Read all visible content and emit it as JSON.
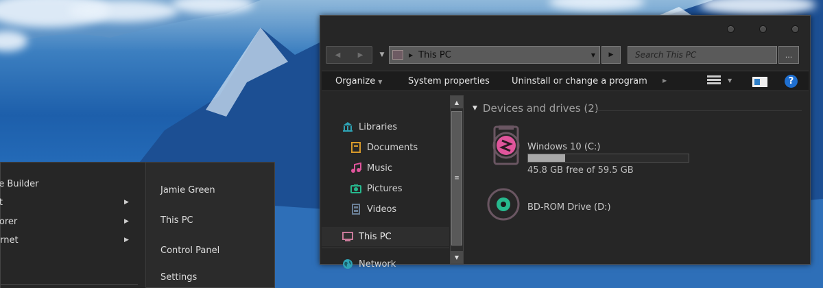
{
  "explorer": {
    "address": {
      "path": "This PC"
    },
    "search": {
      "placeholder": "Search This PC",
      "button_label": "..."
    },
    "commandbar": {
      "organize": "Organize",
      "system_properties": "System properties",
      "uninstall": "Uninstall or change a program"
    },
    "navpane": {
      "items": [
        {
          "label": "Libraries",
          "icon": "library-icon",
          "color": "#2ea3b5"
        },
        {
          "label": "Documents",
          "icon": "document-icon",
          "color": "#d89a2a"
        },
        {
          "label": "Music",
          "icon": "music-icon",
          "color": "#e0559c"
        },
        {
          "label": "Pictures",
          "icon": "camera-icon",
          "color": "#27b98e"
        },
        {
          "label": "Videos",
          "icon": "film-icon",
          "color": "#6a7f96"
        },
        {
          "label": "This PC",
          "icon": "computer-icon",
          "color": "#c97a9a"
        },
        {
          "label": "Network",
          "icon": "globe-icon",
          "color": "#2ea3b5"
        }
      ]
    },
    "content": {
      "group_title": "Devices and drives (2)",
      "drives": [
        {
          "name": "Windows 10 (C:)",
          "free": "45.8 GB free of 59.5 GB",
          "used_fraction": 0.23,
          "icon": "hard-drive-icon",
          "accent": "#e0559c"
        },
        {
          "name": "BD-ROM Drive (D:)",
          "icon": "optical-drive-icon",
          "accent": "#27b98e"
        }
      ]
    }
  },
  "startmenu": {
    "left_items": [
      {
        "label": "yle Builder",
        "has_submenu": false
      },
      {
        "label": "int",
        "has_submenu": true
      },
      {
        "label": "plorer",
        "has_submenu": true
      },
      {
        "label": "ternet",
        "has_submenu": true
      }
    ],
    "right_items": [
      "Jamie Green",
      "This PC",
      "Control Panel",
      "Settings"
    ]
  }
}
